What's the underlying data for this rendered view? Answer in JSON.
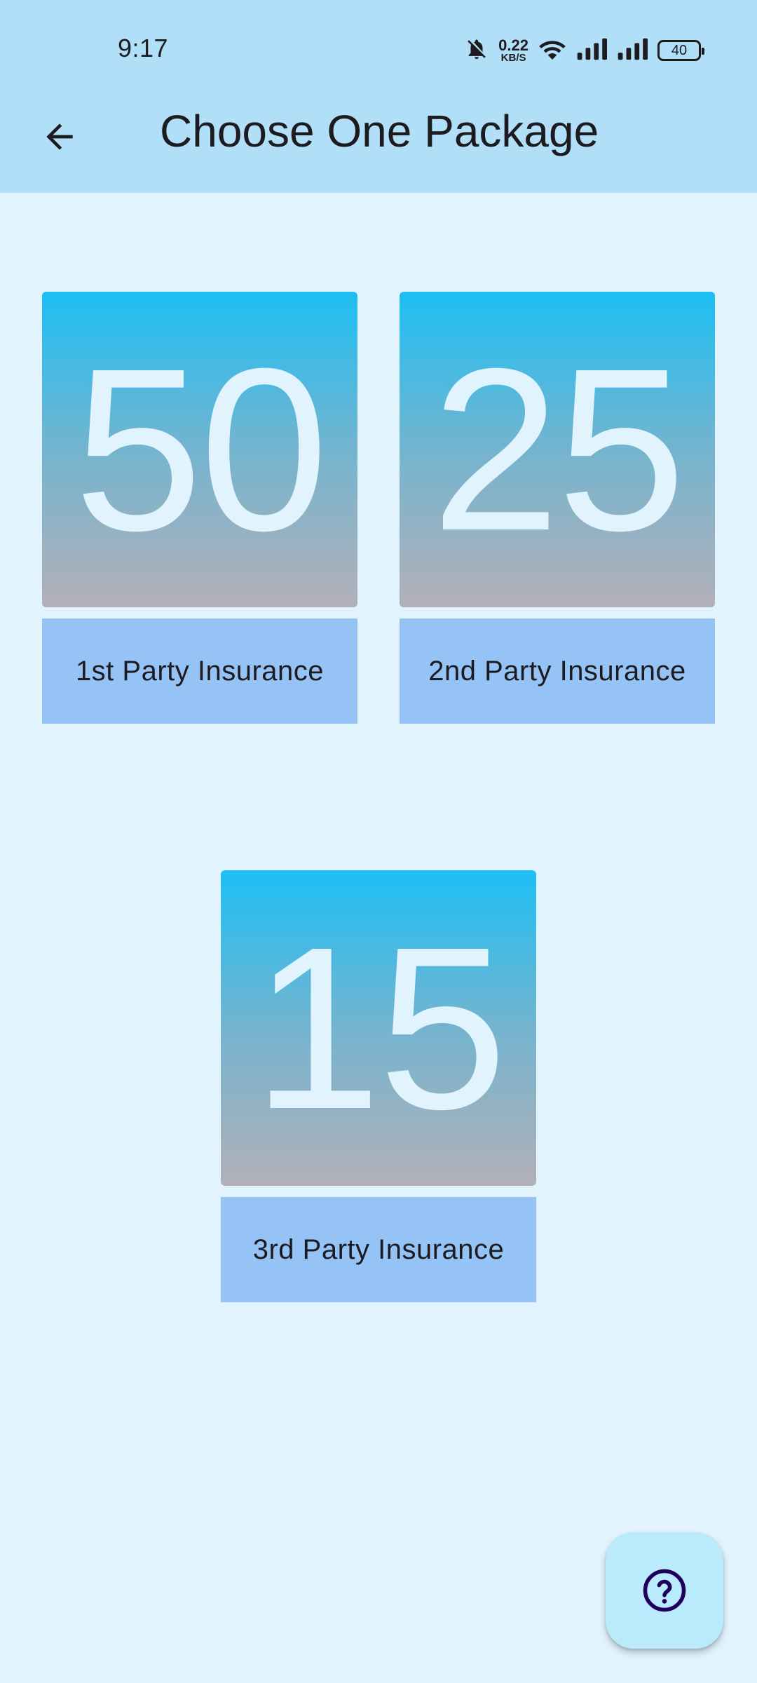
{
  "status_bar": {
    "time": "9:17",
    "net_speed_value": "0.22",
    "net_speed_unit": "KB/S",
    "battery": "40",
    "icons": [
      "bell-muted-icon",
      "wifi-icon",
      "signal-icon",
      "signal-icon",
      "battery-icon"
    ]
  },
  "appbar": {
    "title": "Choose One Package",
    "back_icon": "arrow-left-icon"
  },
  "packages": [
    {
      "number": "50",
      "label": "1st Party Insurance"
    },
    {
      "number": "25",
      "label": "2nd Party Insurance"
    },
    {
      "number": "15",
      "label": "3rd Party Insurance"
    }
  ],
  "fab": {
    "icon": "help-circle-icon"
  },
  "colors": {
    "background": "#e1f4fd",
    "appbar": "#b1dff8",
    "tile_gradient_top": "#1dbff4",
    "tile_gradient_bottom": "#b2b0b8",
    "label_background": "#95c3f6",
    "fab_background": "#b9ebfc",
    "fab_icon": "#21005d"
  }
}
